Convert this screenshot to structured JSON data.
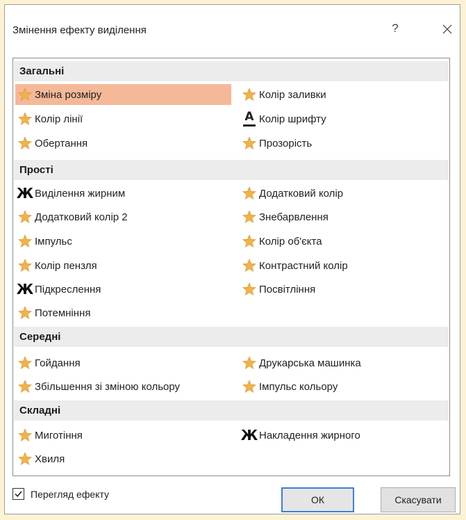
{
  "dialog": {
    "title": "Змінення ефекту виділення",
    "help_label": "?"
  },
  "groups": [
    {
      "header": "Загальні",
      "items": [
        {
          "label": "Зміна розміру",
          "icon": "star-icon",
          "selected": true
        },
        {
          "label": "Колір заливки",
          "icon": "star-icon"
        },
        {
          "label": "Колір лінії",
          "icon": "star-icon"
        },
        {
          "label": "Колір шрифту",
          "icon": "font-color-icon"
        },
        {
          "label": "Обертання",
          "icon": "star-icon"
        },
        {
          "label": "Прозорість",
          "icon": "star-icon"
        }
      ]
    },
    {
      "header": "Прості",
      "items": [
        {
          "label": "Виділення жирним",
          "icon": "bold-icon"
        },
        {
          "label": "Додатковий колір",
          "icon": "star-icon"
        },
        {
          "label": "Додатковий колір 2",
          "icon": "star-icon"
        },
        {
          "label": "Знебарвлення",
          "icon": "star-icon"
        },
        {
          "label": "Імпульс",
          "icon": "star-icon"
        },
        {
          "label": "Колір об'єкта",
          "icon": "star-icon"
        },
        {
          "label": "Колір пензля",
          "icon": "star-icon"
        },
        {
          "label": "Контрастний колір",
          "icon": "star-icon"
        },
        {
          "label": "Підкреслення",
          "icon": "bold-icon"
        },
        {
          "label": "Посвітління",
          "icon": "star-icon"
        },
        {
          "label": "Потемніння",
          "icon": "star-icon"
        }
      ]
    },
    {
      "header": "Середні",
      "items": [
        {
          "label": "Гойдання",
          "icon": "star-icon"
        },
        {
          "label": "Друкарська машинка",
          "icon": "star-icon"
        },
        {
          "label": "Збільшення зі зміною кольору",
          "icon": "star-icon"
        },
        {
          "label": "Імпульс кольору",
          "icon": "star-icon"
        }
      ]
    },
    {
      "header": "Складні",
      "items": [
        {
          "label": "Миготіння",
          "icon": "star-icon"
        },
        {
          "label": "Накладення жирного",
          "icon": "bold-icon"
        },
        {
          "label": "Хвиля",
          "icon": "star-icon"
        }
      ]
    }
  ],
  "icons": {
    "bold_glyph": "Ж",
    "font_color_glyph": "A"
  },
  "footer": {
    "preview_label": "Перегляд ефекту",
    "preview_checked": true,
    "ok_label": "ОК",
    "cancel_label": "Скасувати"
  },
  "colors": {
    "selection": "#f5b898",
    "star": "#f0b24a",
    "group_header_bg": "#ececec",
    "ok_border": "#3c7fd6"
  }
}
